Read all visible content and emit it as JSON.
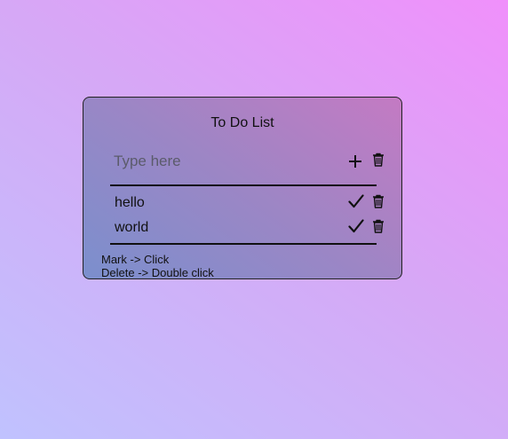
{
  "app": {
    "title": "To Do List"
  },
  "input": {
    "placeholder": "Type here",
    "value": ""
  },
  "items": [
    {
      "label": "hello",
      "mark_icon": "check-icon",
      "delete_icon": "trash-icon"
    },
    {
      "label": "world",
      "mark_icon": "check-icon",
      "delete_icon": "trash-icon"
    }
  ],
  "help": {
    "line1": "Mark -> Click",
    "line2": "Delete -> Double click"
  },
  "colors": {
    "background_start": "#f090fb",
    "background_end": "#c0c2fe",
    "card_start": "#c47ac3",
    "card_end": "#7b8fcd",
    "text": "#111111"
  }
}
